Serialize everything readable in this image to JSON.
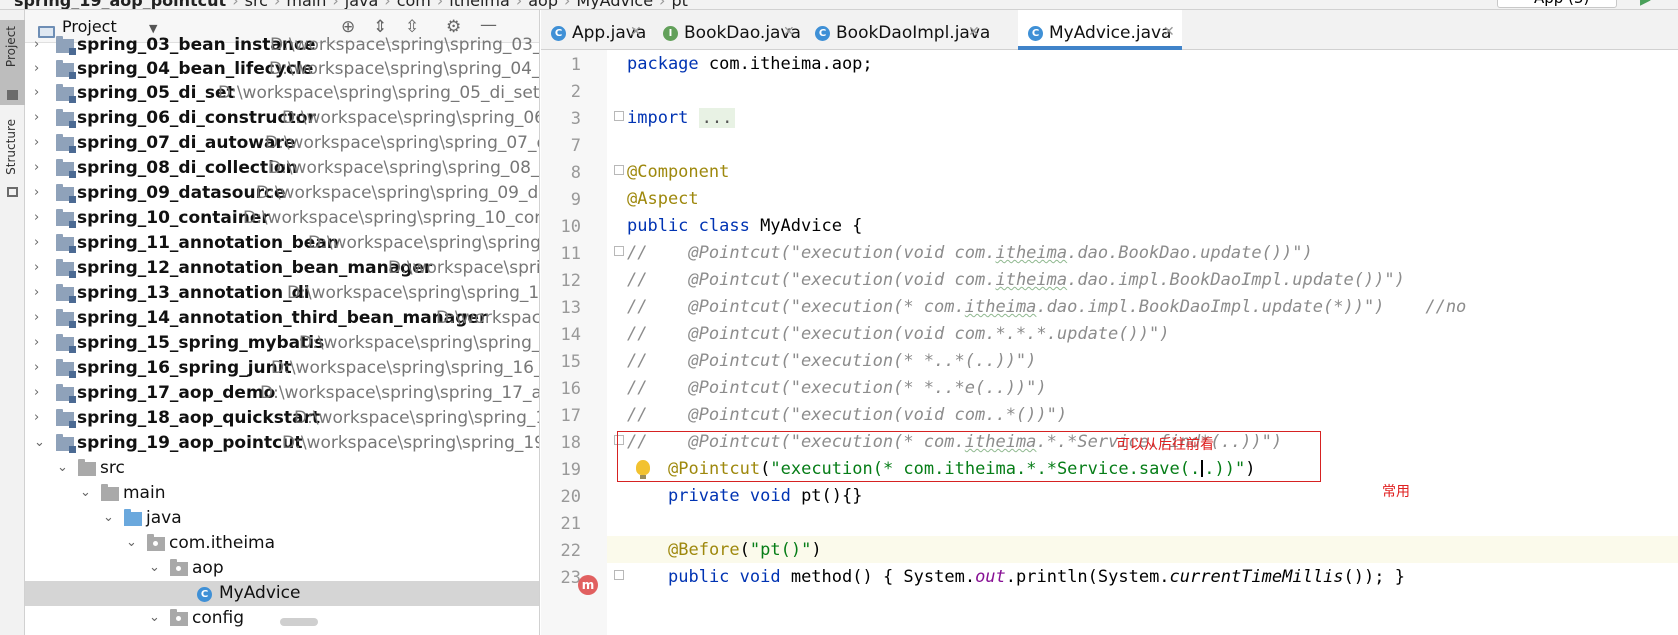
{
  "topbar": {
    "crumbs": [
      "spring_19_aop_pointcut",
      "src",
      "main",
      "java",
      "com",
      "itheima",
      "aop",
      "MyAdvice",
      "pt"
    ],
    "run_config": "App (3)"
  },
  "sidebar": {
    "tabs": [
      {
        "label": "Project",
        "active": true
      },
      {
        "label": "Structure",
        "active": false
      }
    ]
  },
  "project_panel": {
    "title": "Project",
    "header_icons": [
      "locate-icon",
      "expand-all-icon",
      "collapse-all-icon",
      "gear-icon",
      "minimize-icon"
    ],
    "modules": [
      {
        "name": "spring_03_bean_instance",
        "path": "D:\\workspace\\spring\\spring_03_b"
      },
      {
        "name": "spring_04_bean_lifecycle",
        "path": "D:\\workspace\\spring\\spring_04_b"
      },
      {
        "name": "spring_05_di_set",
        "path": "D:\\workspace\\spring\\spring_05_di_set"
      },
      {
        "name": "spring_06_di_constructor",
        "path": "D:\\workspace\\spring\\spring_06_d"
      },
      {
        "name": "spring_07_di_autoware",
        "path": "D:\\workspace\\spring\\spring_07_di_"
      },
      {
        "name": "spring_08_di_collection",
        "path": "D:\\workspace\\spring\\spring_08_di"
      },
      {
        "name": "spring_09_datasource",
        "path": "D:\\workspace\\spring\\spring_09_data"
      },
      {
        "name": "spring_10_container",
        "path": "D:\\workspace\\spring\\spring_10_conta"
      },
      {
        "name": "spring_11_annotation_bean",
        "path": "D:\\workspace\\spring\\spring_1"
      },
      {
        "name": "spring_12_annotation_bean_manager",
        "path": "D:\\workspace\\spring"
      },
      {
        "name": "spring_13_annotation_di",
        "path": "D:\\workspace\\spring\\spring_13_a"
      },
      {
        "name": "spring_14_annotation_third_bean_manager",
        "path": "D:\\workspace"
      },
      {
        "name": "spring_15_spring_mybatis",
        "path": "D:\\workspace\\spring\\spring_15_"
      },
      {
        "name": "spring_16_spring_junit",
        "path": "D:\\workspace\\spring\\spring_16_spr"
      },
      {
        "name": "spring_17_aop_demo",
        "path": "D:\\workspace\\spring\\spring_17_aop_"
      },
      {
        "name": "spring_18_aop_quickstart",
        "path": "D:\\workspace\\spring\\spring_18_"
      },
      {
        "name": "spring_19_aop_pointcut",
        "path": "D:\\workspace\\spring\\spring_19_ac"
      }
    ],
    "subtree": [
      "src",
      "main",
      "java",
      "com.itheima",
      "aop",
      "MyAdvice",
      "config"
    ]
  },
  "tabs": [
    {
      "label": "App.java",
      "icon": "C",
      "color": "#3f90d6"
    },
    {
      "label": "BookDao.java",
      "icon": "I",
      "color": "#62a05a"
    },
    {
      "label": "BookDaoImpl.java",
      "icon": "C",
      "color": "#3f90d6"
    },
    {
      "label": "MyAdvice.java",
      "icon": "C",
      "color": "#3f90d6",
      "active": true
    }
  ],
  "editor": {
    "line_numbers": [
      "1",
      "2",
      "3",
      "7",
      "8",
      "9",
      "10",
      "11",
      "12",
      "13",
      "14",
      "15",
      "16",
      "17",
      "18",
      "19",
      "20",
      "21",
      "22",
      "23"
    ],
    "code": {
      "package_kw": "package",
      "package_name": " com.itheima.aop;",
      "import_kw": "import",
      "import_dots": "...",
      "component": "@Component",
      "aspect": "@Aspect",
      "class_kw": "public class",
      "class_name": " MyAdvice {",
      "c11": "//    @Pointcut(\"execution(void com.",
      "c11b": "itheima",
      "c11c": ".dao.BookDao.update())\")",
      "c12": "//    @Pointcut(\"execution(void com.",
      "c12b": "itheima",
      "c12c": ".dao.impl.BookDaoImpl.update())\")",
      "c13": "//    @Pointcut(\"execution(* com.",
      "c13b": "itheima",
      "c13c": ".dao.impl.BookDaoImpl.update(*))\")    //no",
      "c14": "//    @Pointcut(\"execution(void com.*.*.*.update())\")",
      "c15": "//    @Pointcut(\"execution(* *..*(..))\")",
      "c16": "//    @Pointcut(\"execution(* *..*e(..))\")",
      "c17": "//    @Pointcut(\"execution(void com..*())\")",
      "c18": "//    @Pointcut(\"execution(* com.",
      "c18b": "itheima",
      "c18c": ".*.*Service.find*(..))\")",
      "l19_ann": "@Pointcut",
      "l19_a": "(",
      "l19_str1": "\"execution(* com.itheima.*.*Service.save(.",
      "l19_str2": ".))\"",
      "l19_b": ")",
      "l20_kw": "private void",
      "l20_rest": " pt(){}",
      "l22_ann": "@Before",
      "l22_a": "(",
      "l22_str": "\"pt()\"",
      "l22_b": ")",
      "l23_kw": "public void",
      "l23_a": " method() { System.",
      "l23_out": "out",
      "l23_b": ".println(System.",
      "l23_ctm": "currentTimeMillis",
      "l23_c": "()); }"
    },
    "notes": {
      "line17": "可以从后往前看",
      "line19": "常用"
    },
    "gutter_badge": "m"
  }
}
